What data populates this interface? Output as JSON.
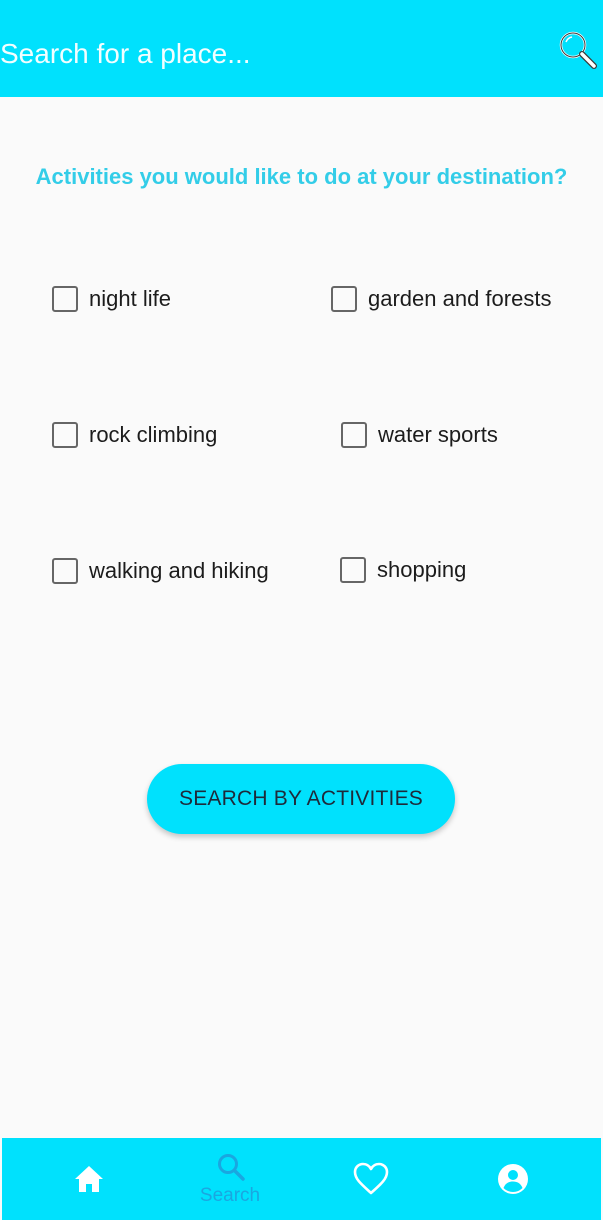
{
  "header": {
    "search_placeholder": "Search for a place..."
  },
  "main": {
    "question": "Activities you would like to do at your destination?",
    "activities": [
      {
        "label": "night life",
        "checked": false
      },
      {
        "label": "garden and forests",
        "checked": false
      },
      {
        "label": "rock climbing",
        "checked": false
      },
      {
        "label": "water sports",
        "checked": false
      },
      {
        "label": "walking and hiking",
        "checked": false
      },
      {
        "label": "shopping",
        "checked": false
      }
    ],
    "search_button_label": "SEARCH BY ACTIVITIES"
  },
  "bottom_nav": {
    "items": [
      {
        "icon": "home-icon",
        "label": ""
      },
      {
        "icon": "search-icon",
        "label": "Search",
        "active": true
      },
      {
        "icon": "heart-icon",
        "label": ""
      },
      {
        "icon": "account-icon",
        "label": ""
      }
    ]
  },
  "colors": {
    "accent": "#00e1fd",
    "question_text": "#33cde8",
    "active_nav": "#1aa7e0"
  }
}
